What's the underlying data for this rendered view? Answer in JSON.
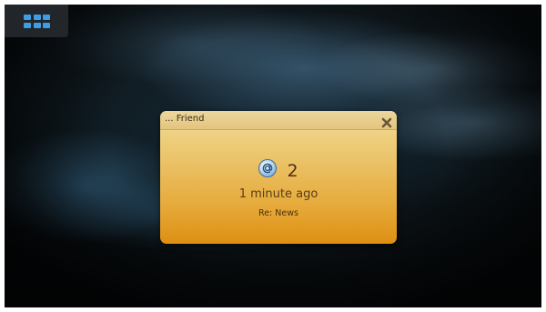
{
  "launcher": {
    "icon": "app-grid-icon",
    "accent_color": "#3d9ee6"
  },
  "notification": {
    "title": "... Friend",
    "close_icon": "close-icon",
    "message_icon": "at-sign-email-icon",
    "count": "2",
    "time": "1 minute ago",
    "subject": "Re: News",
    "background_color": "#e6ab3c"
  }
}
